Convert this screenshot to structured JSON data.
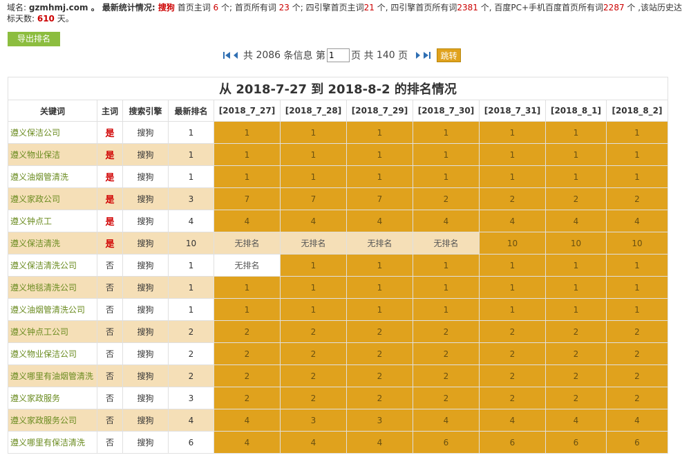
{
  "summary": {
    "domain_label": "域名: ",
    "domain": "gzmhmj.com",
    "after_domain": " 。 最新统计情况: ",
    "engine": "搜狗",
    "t1": " 首页主词 ",
    "home_main": "6",
    "t2": " 个; 首页所有词 ",
    "home_all": "23",
    "t3": " 个; 四引擎首页主词",
    "four_main": "21",
    "t4": " 个, 四引擎首页所有词",
    "four_all": "2381",
    "t5": " 个, 百度PC+手机百度首页所有词",
    "baidu_all": "2287",
    "t6": " 个 ,该站历史达标天数: ",
    "days": "610",
    "t7": " 天。"
  },
  "export_button": "导出排名",
  "pager": {
    "total_prefix": "共 ",
    "total": "2086",
    "total_suffix": " 条信息 第",
    "current_page": "1",
    "pages_prefix": "页 共 ",
    "pages": "140",
    "pages_suffix": " 页",
    "go": "跳转"
  },
  "table": {
    "title": "从 2018-7-27 到 2018-8-2 的排名情况",
    "headers": [
      "关键词",
      "主词",
      "搜索引擎",
      "最新排名",
      "[2018_7_27]",
      "[2018_7_28]",
      "[2018_7_29]",
      "[2018_7_30]",
      "[2018_7_31]",
      "[2018_8_1]",
      "[2018_8_2]"
    ],
    "rows": [
      {
        "keyword": "遵义保洁公司",
        "main": "是",
        "engine": "搜狗",
        "latest": "1",
        "ranks": [
          "1",
          "1",
          "1",
          "1",
          "1",
          "1",
          "1"
        ]
      },
      {
        "keyword": "遵义物业保洁",
        "main": "是",
        "engine": "搜狗",
        "latest": "1",
        "ranks": [
          "1",
          "1",
          "1",
          "1",
          "1",
          "1",
          "1"
        ]
      },
      {
        "keyword": "遵义油烟管清洗",
        "main": "是",
        "engine": "搜狗",
        "latest": "1",
        "ranks": [
          "1",
          "1",
          "1",
          "1",
          "1",
          "1",
          "1"
        ]
      },
      {
        "keyword": "遵义家政公司",
        "main": "是",
        "engine": "搜狗",
        "latest": "3",
        "ranks": [
          "7",
          "7",
          "7",
          "2",
          "2",
          "2",
          "2"
        ]
      },
      {
        "keyword": "遵义钟点工",
        "main": "是",
        "engine": "搜狗",
        "latest": "4",
        "ranks": [
          "4",
          "4",
          "4",
          "4",
          "4",
          "4",
          "4"
        ]
      },
      {
        "keyword": "遵义保洁清洗",
        "main": "是",
        "engine": "搜狗",
        "latest": "10",
        "ranks": [
          "无排名",
          "无排名",
          "无排名",
          "无排名",
          "10",
          "10",
          "10"
        ]
      },
      {
        "keyword": "遵义保洁清洗公司",
        "main": "否",
        "engine": "搜狗",
        "latest": "1",
        "ranks": [
          "无排名",
          "1",
          "1",
          "1",
          "1",
          "1",
          "1"
        ]
      },
      {
        "keyword": "遵义地毯清洗公司",
        "main": "否",
        "engine": "搜狗",
        "latest": "1",
        "ranks": [
          "1",
          "1",
          "1",
          "1",
          "1",
          "1",
          "1"
        ]
      },
      {
        "keyword": "遵义油烟管清洗公司",
        "main": "否",
        "engine": "搜狗",
        "latest": "1",
        "ranks": [
          "1",
          "1",
          "1",
          "1",
          "1",
          "1",
          "1"
        ]
      },
      {
        "keyword": "遵义钟点工公司",
        "main": "否",
        "engine": "搜狗",
        "latest": "2",
        "ranks": [
          "2",
          "2",
          "2",
          "2",
          "2",
          "2",
          "2"
        ]
      },
      {
        "keyword": "遵义物业保洁公司",
        "main": "否",
        "engine": "搜狗",
        "latest": "2",
        "ranks": [
          "2",
          "2",
          "2",
          "2",
          "2",
          "2",
          "2"
        ]
      },
      {
        "keyword": "遵义哪里有油烟管清洗",
        "main": "否",
        "engine": "搜狗",
        "latest": "2",
        "ranks": [
          "2",
          "2",
          "2",
          "2",
          "2",
          "2",
          "2"
        ]
      },
      {
        "keyword": "遵义家政服务",
        "main": "否",
        "engine": "搜狗",
        "latest": "3",
        "ranks": [
          "2",
          "2",
          "2",
          "2",
          "2",
          "2",
          "2"
        ]
      },
      {
        "keyword": "遵义家政服务公司",
        "main": "否",
        "engine": "搜狗",
        "latest": "4",
        "ranks": [
          "4",
          "3",
          "3",
          "4",
          "4",
          "4",
          "4"
        ]
      },
      {
        "keyword": "遵义哪里有保洁清洗",
        "main": "否",
        "engine": "搜狗",
        "latest": "6",
        "ranks": [
          "4",
          "4",
          "4",
          "6",
          "6",
          "6",
          "6"
        ]
      }
    ]
  },
  "colors": {
    "ranked_cell": "#e0a21d",
    "even_row": "#f5dfb7",
    "keyword_link": "#6a8b1f",
    "highlight_red": "#c00000",
    "export_button": "#8cbd3f"
  },
  "icons": {
    "first": "first-page-icon",
    "prev": "prev-page-icon",
    "next": "next-page-icon",
    "last": "last-page-icon"
  }
}
